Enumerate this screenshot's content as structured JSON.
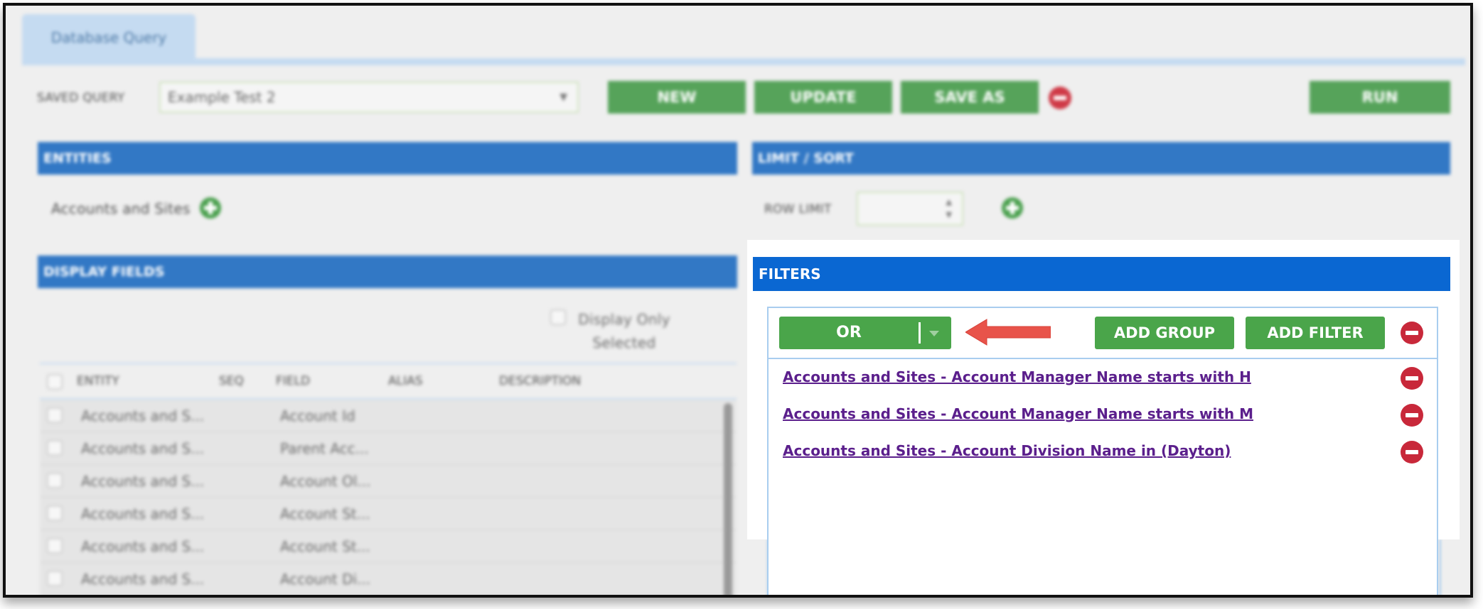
{
  "tab": {
    "label": "Database Query"
  },
  "toolbar": {
    "saved_query_label": "SAVED QUERY",
    "saved_query_value": "Example Test 2",
    "new_label": "NEW",
    "update_label": "UPDATE",
    "save_as_label": "SAVE AS",
    "run_label": "RUN"
  },
  "entities": {
    "title": "ENTITIES",
    "item": "Accounts and Sites"
  },
  "limit_sort": {
    "title": "LIMIT / SORT",
    "row_limit_label": "ROW LIMIT"
  },
  "display_fields": {
    "title": "DISPLAY FIELDS",
    "display_only_selected": "Display Only Selected",
    "columns": [
      "ENTITY",
      "SEQ",
      "FIELD",
      "ALIAS",
      "DESCRIPTION"
    ],
    "rows": [
      {
        "entity": "Accounts and S...",
        "field": "Account Id"
      },
      {
        "entity": "Accounts and S...",
        "field": "Parent Acc..."
      },
      {
        "entity": "Accounts and S...",
        "field": "Account Ol..."
      },
      {
        "entity": "Accounts and S...",
        "field": "Account St..."
      },
      {
        "entity": "Accounts and S...",
        "field": "Account St..."
      },
      {
        "entity": "Accounts and S...",
        "field": "Account Di..."
      }
    ]
  },
  "filters": {
    "title": "FILTERS",
    "operator": "OR",
    "add_group_label": "ADD GROUP",
    "add_filter_label": "ADD FILTER",
    "items": [
      "Accounts and Sites - Account Manager Name starts with H",
      "Accounts and Sites - Account Manager Name starts with M",
      "Accounts and Sites - Account Division Name in (Dayton)"
    ]
  },
  "colors": {
    "header_blue": "#0a67d2",
    "button_green": "#4aa54a",
    "remove_red": "#c8283a",
    "link_purple": "#5b1f8c",
    "arrow": "#e8534a"
  }
}
